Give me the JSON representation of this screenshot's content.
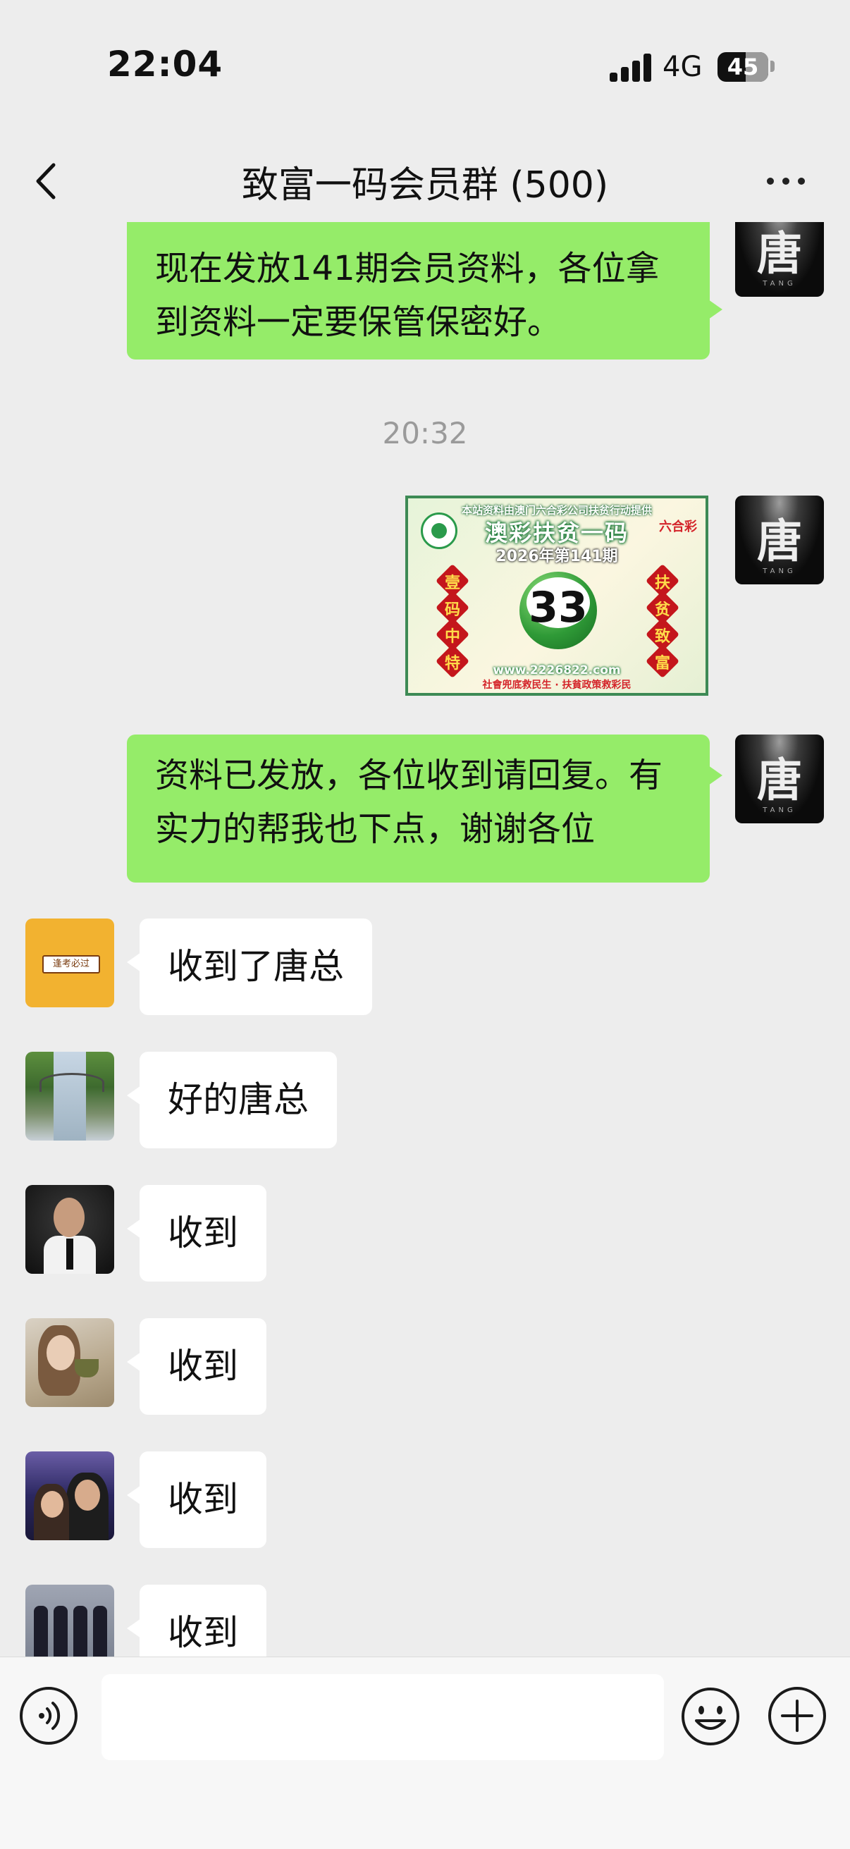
{
  "status_bar": {
    "time": "22:04",
    "network": "4G",
    "battery": "45"
  },
  "nav": {
    "title": "致富一码会员群 (500)"
  },
  "messages": {
    "first_me": "现在发放141期会员资料，各位拿到资料一定要保管保密好。",
    "timestamp": "20:32",
    "second_me": "资料已发放，各位收到请回复。有实力的帮我也下点，谢谢各位",
    "replies": [
      "收到了唐总",
      "好的唐总",
      "收到",
      "收到",
      "收到",
      "收到"
    ]
  },
  "self_avatar": {
    "char": "唐",
    "sub": "TANG"
  },
  "lottery_image": {
    "top_line": "本站资料由澳门六合彩公司扶贫行动提供",
    "title": "澳彩扶贫一码",
    "period": "2026年第141期",
    "brand": "六合彩",
    "left_chars": [
      "壹",
      "码",
      "中",
      "特"
    ],
    "right_chars": [
      "扶",
      "贫",
      "致",
      "富"
    ],
    "number": "33",
    "url": "www.2226822.com",
    "slogan": "社會兜底救民生 · 扶貧政策救彩民"
  },
  "avatar_tag": "逢考必过",
  "input": {
    "value": ""
  },
  "icons": [
    "back-chevron-icon",
    "more-dots-icon",
    "voice-icon",
    "emoji-icon",
    "plus-icon",
    "signal-icon",
    "battery-icon"
  ]
}
